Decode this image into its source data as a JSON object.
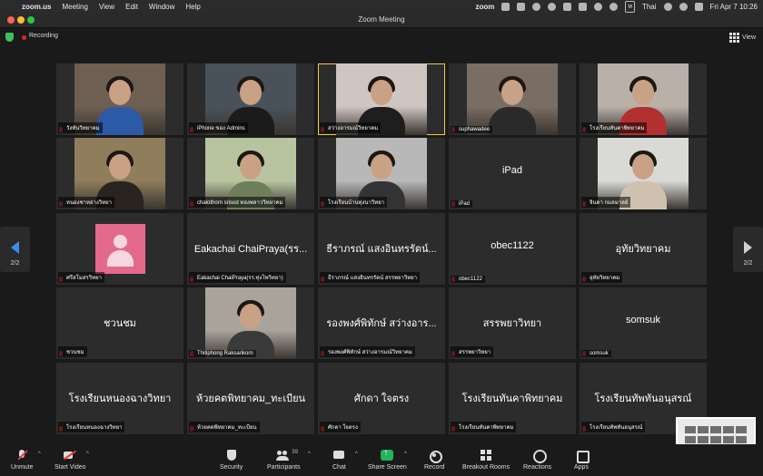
{
  "menubar": {
    "app": "zoom.us",
    "items": [
      "Meeting",
      "View",
      "Edit",
      "Window",
      "Help"
    ],
    "status_app": "zoom",
    "input_language": "Thai",
    "datetime": "Fri Apr 7  10:26"
  },
  "window": {
    "title": "Zoom Meeting"
  },
  "topbar": {
    "recording_label": "Recording",
    "view_label": "View"
  },
  "pagination": {
    "left_label": "2/2",
    "right_label": "2/2"
  },
  "tiles": [
    {
      "name": "วังทันวิทยาคม",
      "video": true,
      "bg": "#6d5f52",
      "fg": "#2d5aa8"
    },
    {
      "name": "iPhone ของ Admins",
      "video": true,
      "bg": "#49525a",
      "fg": "#1b1b1b"
    },
    {
      "name": "สว่างอารมณ์วิทยาคม",
      "video": true,
      "bg": "#cfc6c2",
      "fg": "#1e1e1e",
      "active": true
    },
    {
      "name": "suphawadee",
      "video": true,
      "bg": "#7a6d64",
      "fg": "#2a2a2a"
    },
    {
      "name": "โรงเรียนทันคาพิทยาคม",
      "video": true,
      "bg": "#b9b1a8",
      "fg": "#b23030"
    },
    {
      "name": "หนองชาหย่างวิทยา",
      "video": true,
      "bg": "#8f7d5c",
      "fg": "#2a2420"
    },
    {
      "name": "chalothorn srisod ทองพลาววิทยาคม",
      "video": true,
      "bg": "#b8c4a0",
      "fg": "#6e7e5a"
    },
    {
      "name": "โรงเรียนบ้านทุ่งนาวิทยา",
      "video": true,
      "bg": "#b8b8b8",
      "fg": "#333333"
    },
    {
      "name": "iPad",
      "video": false,
      "title": "iPad"
    },
    {
      "name": "จินดา กมลมาลย์",
      "video": true,
      "bg": "#d9d9d5",
      "fg": "#d0c0b0"
    },
    {
      "name": "ศรีสโมสรวิทยา",
      "video": false,
      "avatar": true
    },
    {
      "name": "Eakachai ChaiPraya(รร.ทุ่งโพวิทยา)",
      "video": false,
      "title": "Eakachai ChaiPraya(รร..."
    },
    {
      "name": "ธีราภรณ์ แสงอินทรรัตน์ สรรพยาวิทยา",
      "video": false,
      "title": "ธีราภรณ์ แสงอินทรรัตน์..."
    },
    {
      "name": "obec1122",
      "video": false,
      "title": "obec1122"
    },
    {
      "name": "อุทัยวิทยาคม",
      "video": false,
      "title": "อุทัยวิทยาคม"
    },
    {
      "name": "ชวนชม",
      "video": false,
      "title": "ชวนชม"
    },
    {
      "name": "Thitiphong Raksarikorn",
      "video": true,
      "bg": "#a8a49c",
      "fg": "#3a3a3a"
    },
    {
      "name": "รองพงศ์พิทักษ์ สว่างอารมณ์วิทยาคม",
      "video": false,
      "title": "รองพงศ์พิทักษ์ สว่างอาร..."
    },
    {
      "name": "สรรพยาวิทยา",
      "video": false,
      "title": "สรรพยาวิทยา"
    },
    {
      "name": "somsuk",
      "video": false,
      "title": "somsuk"
    },
    {
      "name": "โรงเรียนหนองฉางวิทยา",
      "video": false,
      "title": "โรงเรียนหนองฉางวิทยา"
    },
    {
      "name": "ห้วยคตพิทยาคม_ทะเบียน",
      "video": false,
      "title": "ห้วยคตพิทยาคม_ทะเบียน"
    },
    {
      "name": "ศักดา ใจตรง",
      "video": false,
      "title": "ศักดา ใจตรง"
    },
    {
      "name": "โรงเรียนทันคาพิทยาคม",
      "video": false,
      "title": "โรงเรียนทันคาพิทยาคม"
    },
    {
      "name": "โรงเรียนทัพทันอนุสรณ์",
      "video": false,
      "title": "โรงเรียนทัพทันอนุสรณ์"
    }
  ],
  "toolbar": {
    "unmute": "Unmute",
    "start_video": "Start Video",
    "security": "Security",
    "participants": "Participants",
    "participant_count": "39",
    "chat": "Chat",
    "share_screen": "Share Screen",
    "record": "Record",
    "breakout_rooms": "Breakout Rooms",
    "reactions": "Reactions",
    "apps": "Apps"
  },
  "colors": {
    "accent_blue": "#3d8ee8",
    "share_green": "#23b35a",
    "recording_red": "#e02828",
    "active_speaker": "#f2c94c"
  }
}
